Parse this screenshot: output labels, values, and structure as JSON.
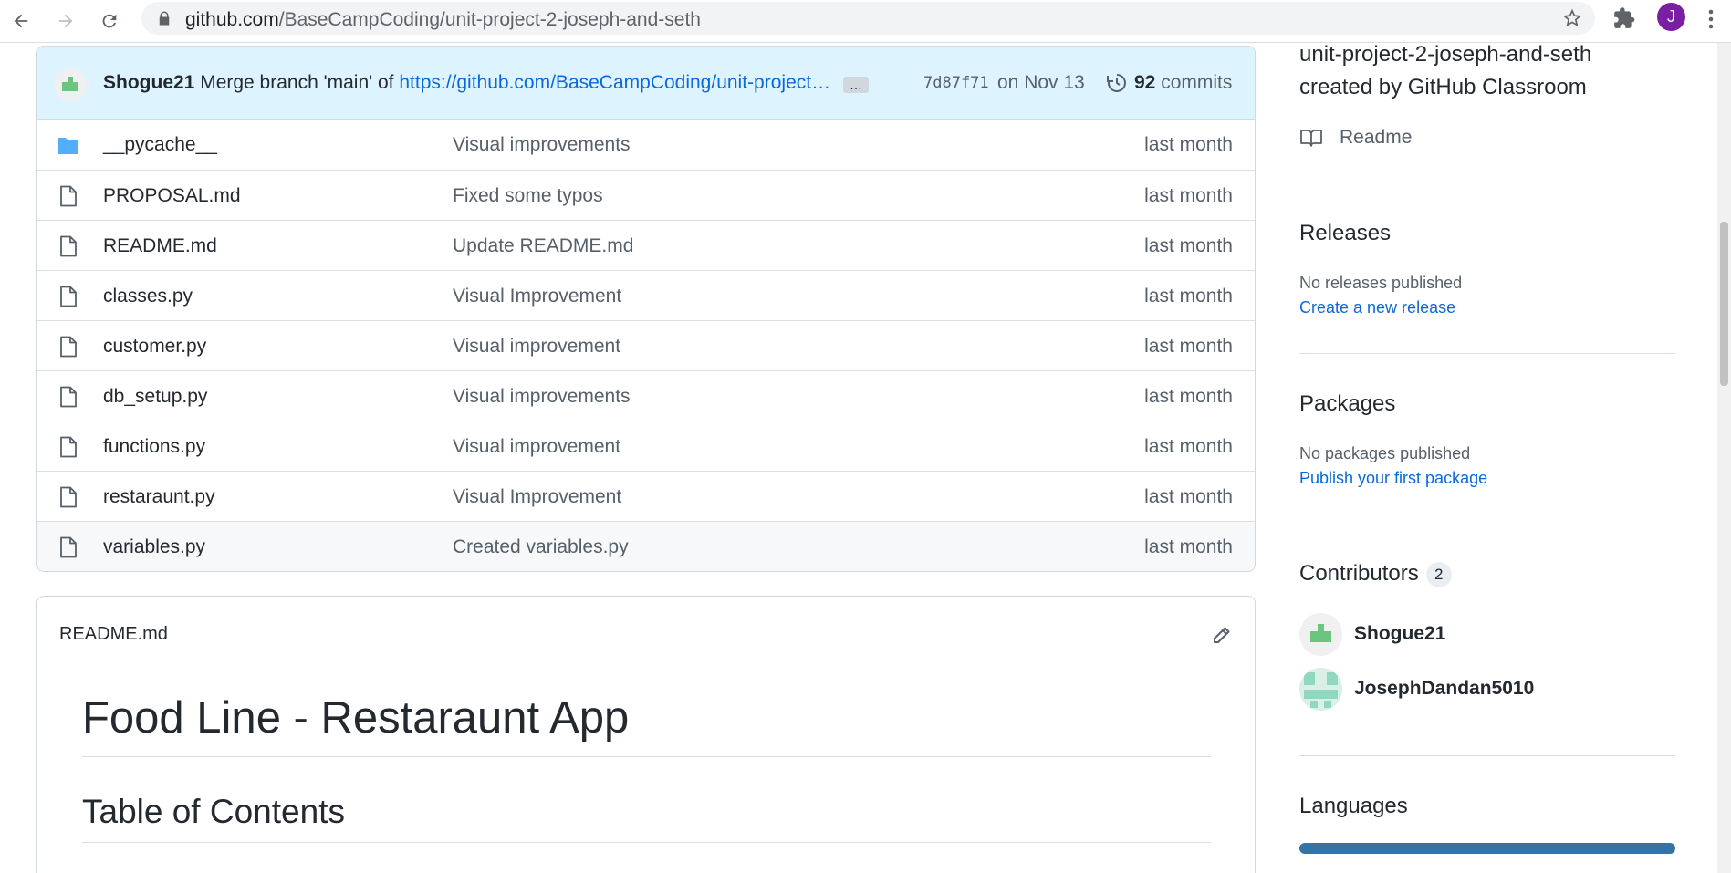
{
  "browser": {
    "url_host": "github.com",
    "url_path": "/BaseCampCoding/unit-project-2-joseph-and-seth",
    "profile_initial": "J"
  },
  "commit_bar": {
    "author": "Shogue21",
    "message": "Merge branch 'main' of",
    "link": "https://github.com/BaseCampCoding/unit-project…",
    "ellipsis": "…",
    "sha": "7d87f71",
    "date": "on Nov 13",
    "commits_count": "92",
    "commits_label": "commits"
  },
  "files": [
    {
      "name": "__pycache__",
      "type": "folder",
      "message": "Visual improvements",
      "age": "last month"
    },
    {
      "name": "PROPOSAL.md",
      "type": "file",
      "message": "Fixed some typos",
      "age": "last month"
    },
    {
      "name": "README.md",
      "type": "file",
      "message": "Update README.md",
      "age": "last month"
    },
    {
      "name": "classes.py",
      "type": "file",
      "message": "Visual Improvement",
      "age": "last month"
    },
    {
      "name": "customer.py",
      "type": "file",
      "message": "Visual improvement",
      "age": "last month"
    },
    {
      "name": "db_setup.py",
      "type": "file",
      "message": "Visual improvements",
      "age": "last month"
    },
    {
      "name": "functions.py",
      "type": "file",
      "message": "Visual improvement",
      "age": "last month"
    },
    {
      "name": "restaraunt.py",
      "type": "file",
      "message": "Visual Improvement",
      "age": "last month"
    },
    {
      "name": "variables.py",
      "type": "file",
      "message": "Created variables.py",
      "age": "last month"
    }
  ],
  "readme": {
    "header": "README.md",
    "h1": "Food Line - Restaraunt App",
    "h2": "Table of Contents"
  },
  "sidebar": {
    "about_line1": "unit-project-2-joseph-and-seth",
    "about_line2": "created by GitHub Classroom",
    "readme_label": "Readme",
    "releases": {
      "heading": "Releases",
      "status": "No releases published",
      "link": "Create a new release"
    },
    "packages": {
      "heading": "Packages",
      "status": "No packages published",
      "link": "Publish your first package"
    },
    "contributors": {
      "heading": "Contributors",
      "count": "2",
      "items": [
        {
          "name": "Shogue21"
        },
        {
          "name": "JosephDandan5010"
        }
      ]
    },
    "languages": {
      "heading": "Languages",
      "bar_color": "#3572a5"
    }
  },
  "colors": {
    "link": "#0969da",
    "commit_bar_bg": "#ddf4ff",
    "folder": "#54aeff",
    "profile": "#7b1fa2"
  }
}
